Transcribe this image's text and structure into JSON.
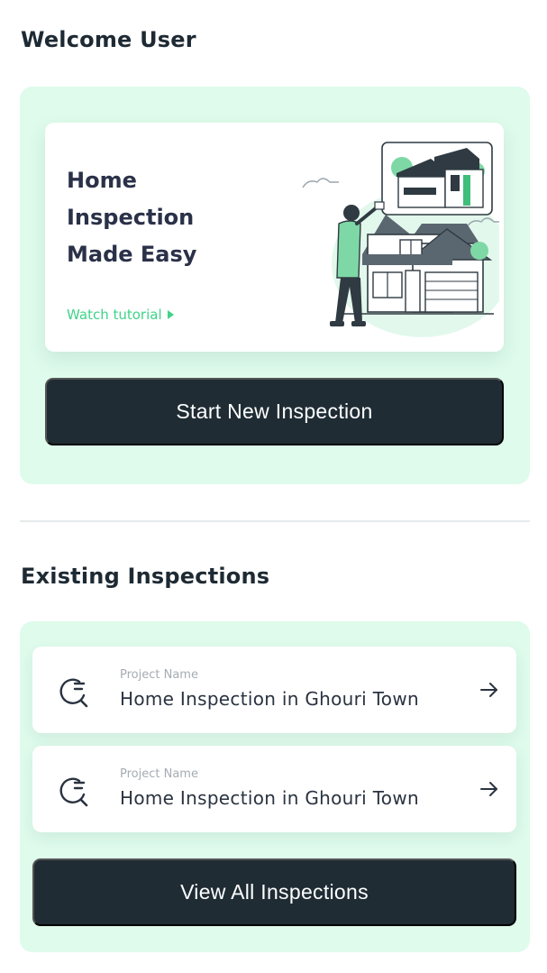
{
  "welcome": {
    "title": "Welcome User"
  },
  "hero": {
    "headline": [
      "Home",
      "Inspection",
      "Made Easy"
    ],
    "tutorial_label": "Watch tutorial",
    "start_button_label": "Start New Inspection"
  },
  "existing": {
    "title": "Existing Inspections",
    "items": [
      {
        "caption": "Project Name",
        "title": "Home Inspection in Ghouri Town"
      },
      {
        "caption": "Project Name",
        "title": "Home Inspection in Ghouri Town"
      }
    ],
    "view_all_label": "View All Inspections"
  },
  "colors": {
    "accent_green": "#3fd389",
    "panel_mint": "#defbec",
    "button_dark": "#1f2c34",
    "headline_navy": "#2a3148"
  },
  "icons": {
    "play": "play-icon",
    "search_doc": "search-document-icon",
    "arrow": "arrow-right-icon"
  }
}
